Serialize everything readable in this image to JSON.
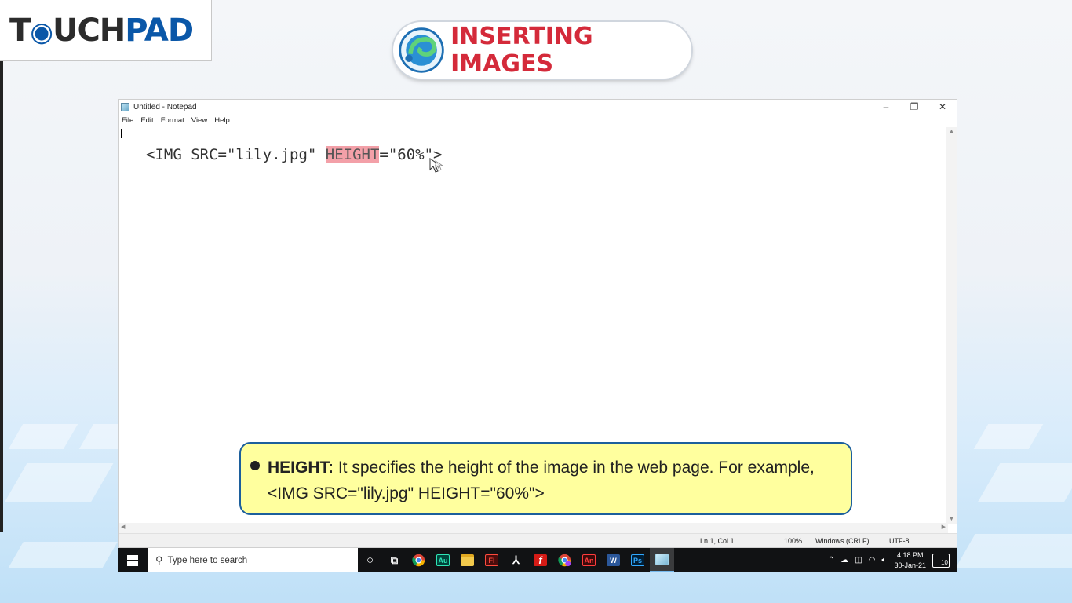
{
  "logo": {
    "part1": "T",
    "part2": "UCH",
    "part3": "PAD"
  },
  "title": {
    "text": "INSERTING IMAGES"
  },
  "notepad": {
    "window_title": "Untitled - Notepad",
    "menu": [
      "File",
      "Edit",
      "Format",
      "View",
      "Help"
    ],
    "code": {
      "before": "<IMG SRC=\"lily.jpg\" ",
      "highlight": "HEIGHT",
      "after": "=\"60%\">"
    },
    "status": {
      "position": "Ln 1, Col 1",
      "zoom": "100%",
      "line_ending": "Windows (CRLF)",
      "encoding": "UTF-8"
    }
  },
  "callout": {
    "term": "HEIGHT:",
    "text": " It specifies the height of the image in the web page. For example,",
    "example": "<IMG SRC=\"lily.jpg\" HEIGHT=\"60%\">"
  },
  "taskbar": {
    "search_placeholder": "Type here to search",
    "apps": [
      {
        "name": "cortana-icon",
        "label": "O"
      },
      {
        "name": "task-view-icon",
        "label": "⫿"
      },
      {
        "name": "chrome-icon",
        "label": ""
      },
      {
        "name": "audition-icon",
        "label": "Au"
      },
      {
        "name": "file-explorer-icon",
        "label": ""
      },
      {
        "name": "fireworks-icon",
        "label": "Fl"
      },
      {
        "name": "acrobat-icon",
        "label": "A"
      },
      {
        "name": "flash-icon",
        "label": "f"
      },
      {
        "name": "chrome-profile-icon",
        "label": ""
      },
      {
        "name": "animate-icon",
        "label": "An"
      },
      {
        "name": "word-icon",
        "label": "W"
      },
      {
        "name": "photoshop-icon",
        "label": "Ps"
      },
      {
        "name": "notepad-icon",
        "label": ""
      }
    ],
    "time": "4:18 PM",
    "date": "30-Jan-21",
    "notification_count": "10"
  },
  "colors": {
    "accent_red": "#d42a3a",
    "brand_blue": "#0a57a8",
    "callout_bg": "#ffff9e",
    "highlight": "#f3a0a8"
  }
}
